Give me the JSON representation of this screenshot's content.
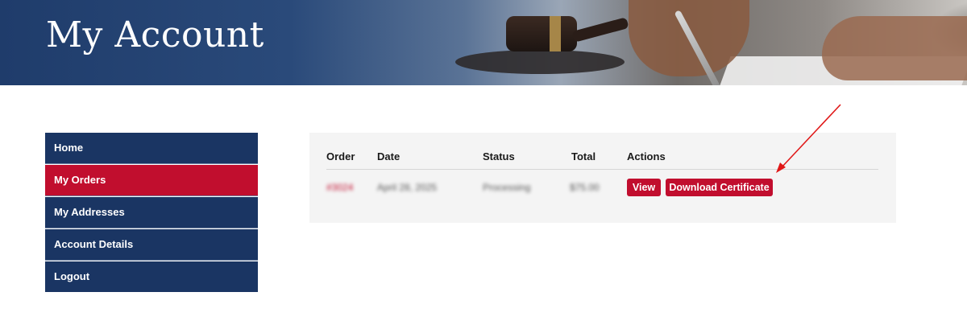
{
  "header": {
    "title": "My Account"
  },
  "sidebar": {
    "items": [
      {
        "label": "Home",
        "active": false
      },
      {
        "label": "My Orders",
        "active": true
      },
      {
        "label": "My Addresses",
        "active": false
      },
      {
        "label": "Account Details",
        "active": false
      },
      {
        "label": "Logout",
        "active": false
      }
    ]
  },
  "orders": {
    "columns": [
      "Order",
      "Date",
      "Status",
      "Total",
      "Actions"
    ],
    "rows": [
      {
        "order": "#3024",
        "date": "April 28, 2025",
        "status": "Processing",
        "total": "$75.00",
        "actions": [
          "View",
          "Download Certificate"
        ]
      }
    ]
  },
  "colors": {
    "nav_bg": "#1a3563",
    "accent_red": "#c10e2e",
    "panel_bg": "#f4f4f4"
  },
  "annotation": {
    "arrow_icon": "red-arrow-icon"
  }
}
